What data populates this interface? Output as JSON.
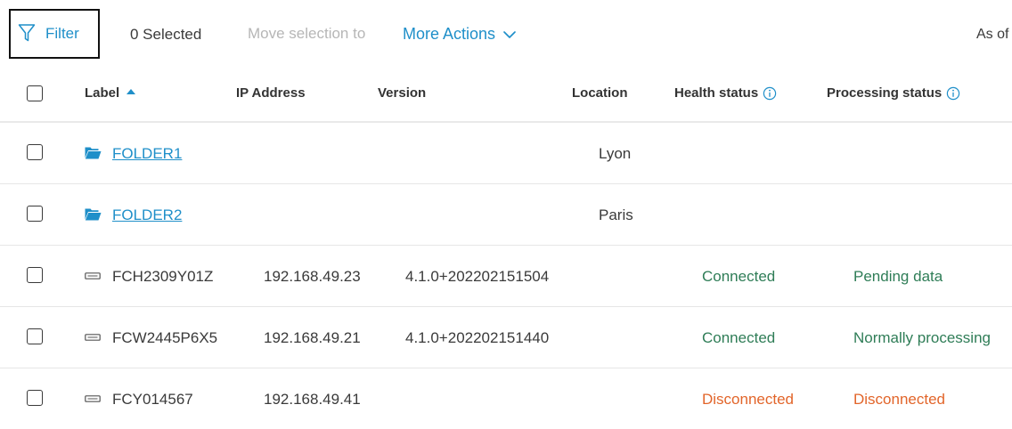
{
  "toolbar": {
    "filter_label": "Filter",
    "selected_count": "0 Selected",
    "move_selection_label": "Move selection to",
    "more_actions_label": "More Actions",
    "as_of_text": "As of"
  },
  "table": {
    "columns": {
      "label": "Label",
      "ip": "IP Address",
      "version": "Version",
      "location": "Location",
      "health": "Health status",
      "processing": "Processing status"
    },
    "sort": {
      "column": "label",
      "direction": "ascending"
    },
    "rows": [
      {
        "type": "folder",
        "label": "FOLDER1",
        "ip": "",
        "version": "",
        "location": "Lyon",
        "health": "",
        "processing": ""
      },
      {
        "type": "folder",
        "label": "FOLDER2",
        "ip": "",
        "version": "",
        "location": "Paris",
        "health": "",
        "processing": ""
      },
      {
        "type": "device",
        "label": "FCH2309Y01Z",
        "ip": "192.168.49.23",
        "version": "4.1.0+202202151504",
        "location": "",
        "health": "Connected",
        "processing": "Pending data"
      },
      {
        "type": "device",
        "label": "FCW2445P6X5",
        "ip": "192.168.49.21",
        "version": "4.1.0+202202151440",
        "location": "",
        "health": "Connected",
        "processing": "Normally processing"
      },
      {
        "type": "device",
        "label": "FCY014567",
        "ip": "192.168.49.41",
        "version": "",
        "location": "",
        "health": "Disconnected",
        "processing": "Disconnected"
      }
    ]
  },
  "icons": {
    "filter": "filter-funnel-icon",
    "more_actions": "chevron-down-icon",
    "sort": "sort-ascending-icon",
    "info": "info-circle-icon",
    "folder": "folder-icon",
    "device": "device-icon"
  },
  "colors": {
    "accent": "#1f8fc9",
    "connected": "#2f7d57",
    "disconnected": "#e2652a",
    "disabled_text": "#b6b6b6"
  }
}
